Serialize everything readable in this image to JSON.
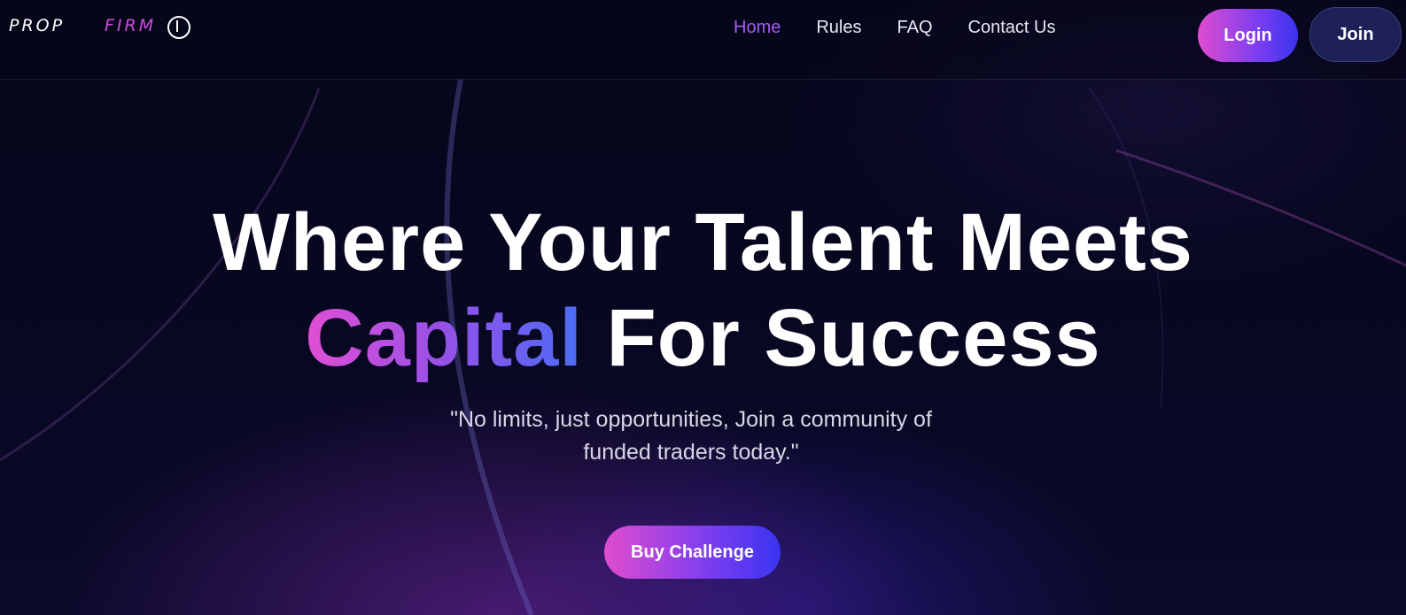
{
  "brand": {
    "logo_part1": "PROP",
    "logo_part2": "FIRM",
    "accent_color": "#d04be0"
  },
  "nav": {
    "items": [
      {
        "label": "Home",
        "active": true
      },
      {
        "label": "Rules",
        "active": false
      },
      {
        "label": "FAQ",
        "active": false
      },
      {
        "label": "Contact Us",
        "active": false
      }
    ],
    "login_label": "Login",
    "join_label": "Join"
  },
  "hero": {
    "title_line1": "Where Your Talent Meets",
    "title_highlight": "Capital",
    "title_line2_rest": " For Success",
    "quote": "\"No limits, just opportunities, Join a community of funded traders today.\"",
    "cta_label": "Buy Challenge"
  },
  "colors": {
    "nav_active": "#a15ef0",
    "gradient_start": "#e04ccf",
    "gradient_end": "#3a34f0",
    "join_bg": "#1d2157",
    "background": "#06061a"
  },
  "icons": [
    "logo-mark-icon"
  ]
}
